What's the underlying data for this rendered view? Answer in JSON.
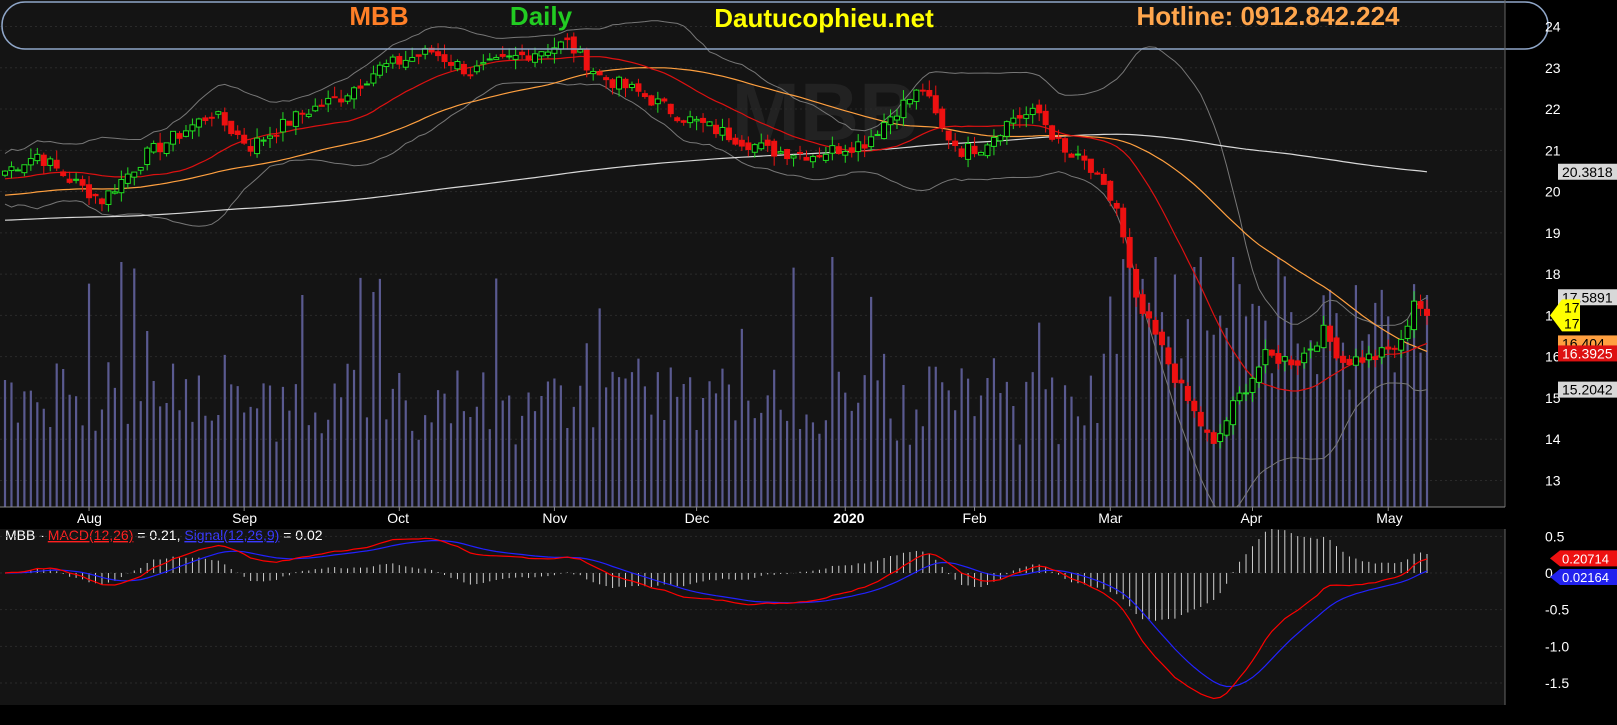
{
  "header": {
    "ticker": "MBB",
    "period": "Daily",
    "site": "Dautucophieu.net",
    "hotline": "Hotline: 0912.842.224",
    "watermark": "MBB"
  },
  "colors": {
    "ticker": "#ff7f27",
    "period": "#22cc22",
    "site": "#ffff00",
    "hotline": "#ffa64d",
    "up": "#22dd22",
    "down": "#ee1111",
    "ma20": "#dd1111",
    "ma50": "#ffa040",
    "ma200": "#d8d8d8",
    "bb": "#777777",
    "volume": "#5a5a90",
    "macd": "#ff0000",
    "signal": "#2222ff"
  },
  "chart_data": [
    {
      "type": "candlestick",
      "title": "MBB Daily",
      "ylim": [
        12.6,
        24.4
      ],
      "yticks": [
        13,
        14,
        15,
        16,
        17,
        18,
        19,
        20,
        21,
        22,
        23,
        24
      ],
      "ytick_labels": [
        "13",
        "14",
        "15",
        "16",
        "17",
        "18",
        "19",
        "20",
        "21",
        "22",
        "23",
        "24"
      ],
      "xtick_labels": [
        "Aug",
        "Sep",
        "Oct",
        "Nov",
        "Dec",
        "2020",
        "Feb",
        "Mar",
        "Apr",
        "May"
      ],
      "xtick_bar_index": [
        13,
        37,
        61,
        85,
        107,
        130,
        150,
        171,
        193,
        214
      ],
      "close_anchors": [
        [
          0,
          20.5
        ],
        [
          5,
          20.9
        ],
        [
          10,
          20.3
        ],
        [
          15,
          19.8
        ],
        [
          22,
          20.9
        ],
        [
          32,
          21.9
        ],
        [
          38,
          21.1
        ],
        [
          46,
          21.9
        ],
        [
          52,
          22.3
        ],
        [
          58,
          23.0
        ],
        [
          66,
          23.4
        ],
        [
          72,
          22.9
        ],
        [
          82,
          23.4
        ],
        [
          87,
          23.6
        ],
        [
          92,
          22.8
        ],
        [
          98,
          22.4
        ],
        [
          105,
          21.8
        ],
        [
          110,
          21.5
        ],
        [
          118,
          21.0
        ],
        [
          125,
          20.9
        ],
        [
          133,
          21.2
        ],
        [
          138,
          22.0
        ],
        [
          142,
          22.5
        ],
        [
          145,
          21.5
        ],
        [
          148,
          21.0
        ],
        [
          151,
          21.1
        ],
        [
          156,
          21.8
        ],
        [
          160,
          21.9
        ],
        [
          164,
          20.9
        ],
        [
          167,
          20.7
        ],
        [
          172,
          19.6
        ],
        [
          175,
          17.3
        ],
        [
          178,
          16.5
        ],
        [
          182,
          15.2
        ],
        [
          187,
          13.8
        ],
        [
          190,
          14.8
        ],
        [
          195,
          16.0
        ],
        [
          200,
          15.9
        ],
        [
          204,
          16.6
        ],
        [
          207,
          15.9
        ],
        [
          212,
          16.0
        ],
        [
          216,
          16.3
        ],
        [
          218,
          17.4
        ],
        [
          220,
          17.0
        ]
      ],
      "bar_count": 221,
      "last_close": 17,
      "legend": {
        "ma200_value": "20.3818",
        "bb_upper_value": "17.5891",
        "price_label_1": "17",
        "price_label_2": "17",
        "ma50_value": "16.404",
        "ma20_value": "16.3925",
        "bb_lower_value": "15.2042"
      }
    },
    {
      "type": "line",
      "title": "MBB - MACD(12,26) = 0.21, Signal(12,26,9) = 0.02",
      "legend_parts": {
        "ticker": "MBB - ",
        "macd_name": "MACD(12,26)",
        "macd_eq": " = 0.21, ",
        "signal_name": "Signal(12,26,9)",
        "signal_eq": " = 0.02"
      },
      "ylim": [
        -1.8,
        0.6
      ],
      "yticks": [
        0.5,
        0,
        -0.5,
        -1.0,
        -1.5
      ],
      "ytick_labels": [
        "0.5",
        "0",
        "-0.5",
        "-1.0",
        "-1.5"
      ],
      "macd_value_label": "0.20714",
      "signal_value_label": "0.02164"
    }
  ]
}
